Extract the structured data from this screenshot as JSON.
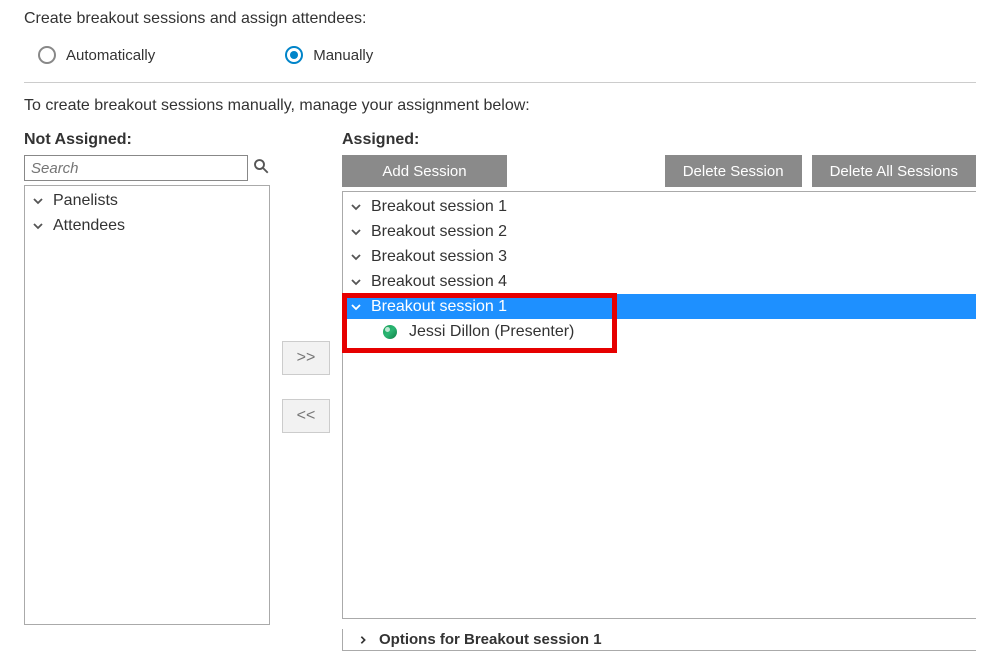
{
  "header": "Create breakout sessions and assign attendees:",
  "radios": {
    "automatically": "Automatically",
    "manually": "Manually",
    "selected": "manually"
  },
  "instruction": "To create breakout sessions manually, manage your assignment below:",
  "not_assigned": {
    "heading": "Not Assigned:",
    "search_placeholder": "Search",
    "groups": [
      "Panelists",
      "Attendees"
    ]
  },
  "move": {
    "add": ">>",
    "remove": "<<"
  },
  "assigned": {
    "heading": "Assigned:",
    "buttons": {
      "add_session": "Add Session",
      "delete_session": "Delete Session",
      "delete_all_sessions": "Delete All Sessions"
    },
    "sessions": [
      {
        "label": "Breakout session 1",
        "expanded": false
      },
      {
        "label": "Breakout session 2",
        "expanded": false
      },
      {
        "label": "Breakout session 3",
        "expanded": false
      },
      {
        "label": "Breakout session 4",
        "expanded": false
      },
      {
        "label": "Breakout session 1",
        "expanded": true,
        "selected": true,
        "attendees": [
          {
            "name": "Jessi Dillon (Presenter)"
          }
        ]
      }
    ],
    "options_label": "Options for Breakout session 1"
  }
}
